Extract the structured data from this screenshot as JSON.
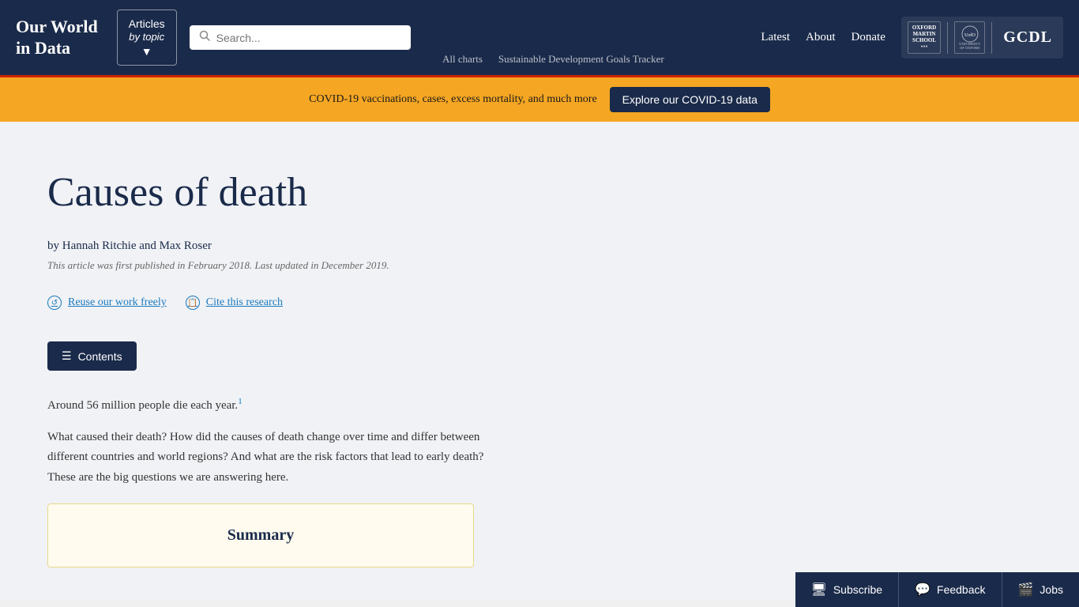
{
  "site": {
    "title_line1": "Our World",
    "title_line2": "in Data"
  },
  "header": {
    "articles_label": "Articles",
    "by_topic_label": "by topic",
    "search_placeholder": "Search...",
    "all_charts_label": "All charts",
    "sdg_tracker_label": "Sustainable Development Goals Tracker",
    "latest_label": "Latest",
    "about_label": "About",
    "donate_label": "Donate"
  },
  "covid_banner": {
    "text": "COVID-19 vaccinations, cases, excess mortality, and much more",
    "button_label": "Explore our COVID-19 data"
  },
  "article": {
    "title": "Causes of death",
    "author_prefix": "by ",
    "authors": "Hannah Ritchie and Max Roser",
    "pub_date": "This article was first published in February 2018. Last updated in December 2019.",
    "reuse_label": "Reuse our work freely",
    "cite_label": "Cite this research",
    "contents_label": "Contents",
    "intro_paragraph1": "Around 56 million people die each year.",
    "footnote_ref": "1",
    "intro_paragraph2": "What caused their death? How did the causes of death change over time and differ between different countries and world regions? And what are the risk factors that lead to early death? These are the big questions we are answering here.",
    "summary_title": "Summary"
  },
  "footer": {
    "subscribe_label": "Subscribe",
    "feedback_label": "Feedback",
    "jobs_label": "Jobs"
  },
  "logos": {
    "oxford_line1": "OXFORD",
    "oxford_line2": "MARTIN",
    "oxford_line3": "SCHOOL",
    "uox_label": "UNIVERSITY OF OXFORD",
    "gcdl_label": "GCDL"
  }
}
